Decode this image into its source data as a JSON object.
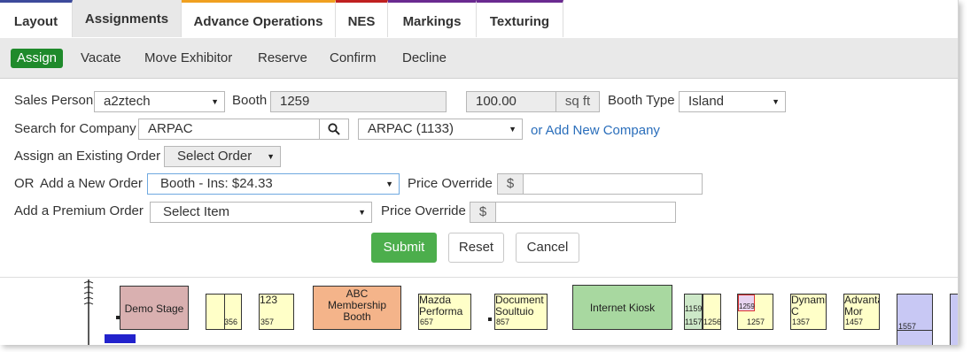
{
  "tabs": [
    "Layout",
    "Assignments",
    "Advance Operations",
    "NES",
    "Markings",
    "Texturing"
  ],
  "tab_colors": [
    "#3c4a9b",
    "#ffffff",
    "#f0a020",
    "#c02020",
    "#6a2a90",
    "#6a2a90"
  ],
  "actions": {
    "assign": "Assign",
    "vacate": "Vacate",
    "move": "Move Exhibitor",
    "reserve": "Reserve",
    "confirm": "Confirm",
    "decline": "Decline"
  },
  "form": {
    "sales_person_label": "Sales Person",
    "sales_person_value": "a2ztech",
    "booth_label": "Booth",
    "booth_value": "1259",
    "sqft_value": "100.00",
    "sqft_unit": "sq ft",
    "booth_type_label": "Booth Type",
    "booth_type_value": "Island",
    "search_label": "Search for Company",
    "search_value": "ARPAC",
    "company_select": "ARPAC (1133)",
    "add_company_link": "or Add New Company",
    "existing_order_label": "Assign an Existing Order",
    "existing_order_value": "Select Order",
    "or_label": "OR",
    "new_order_label": "Add a New Order",
    "new_order_value": "Booth - Ins: $24.33",
    "price_override_label": "Price Override",
    "currency": "$",
    "premium_label": "Add a Premium Order",
    "premium_value": "Select Item",
    "price_override_label2": "Price Override"
  },
  "buttons": {
    "submit": "Submit",
    "reset": "Reset",
    "cancel": "Cancel"
  },
  "map": {
    "demo_stage": "Demo Stage",
    "b356": "356",
    "b123": "123",
    "b357": "357",
    "abc": "ABC Membership Booth",
    "mazda": "Mazda Performa",
    "b657": "657",
    "document": "Document Soultuio",
    "b857": "857",
    "kiosk": "Internet Kiosk",
    "b1159": "1159",
    "b1157": "1157",
    "b1256": "1256",
    "b1259": "1259",
    "b1257": "1257",
    "dyna": "Dynamic C",
    "b1357": "1357",
    "advan": "Advanta Mor",
    "b1457": "1457",
    "b1557": "1557"
  }
}
